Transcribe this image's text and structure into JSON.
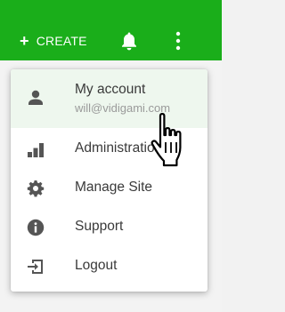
{
  "topbar": {
    "brand_color": "#1aae1a",
    "create_label": "CREATE",
    "create_icon": "plus-icon",
    "notifications_icon": "bell-icon",
    "more_icon": "kebab-menu-icon"
  },
  "menu": {
    "items": [
      {
        "icon": "person-icon",
        "label": "My account",
        "sublabel": "will@vidigami.com"
      },
      {
        "icon": "bar-chart-icon",
        "label": "Administration"
      },
      {
        "icon": "gear-icon",
        "label": "Manage Site"
      },
      {
        "icon": "info-icon",
        "label": "Support"
      },
      {
        "icon": "logout-icon",
        "label": "Logout"
      }
    ],
    "highlight_color": "#eef7ee"
  },
  "cursor": {
    "icon": "hand-pointer-cursor-icon"
  }
}
